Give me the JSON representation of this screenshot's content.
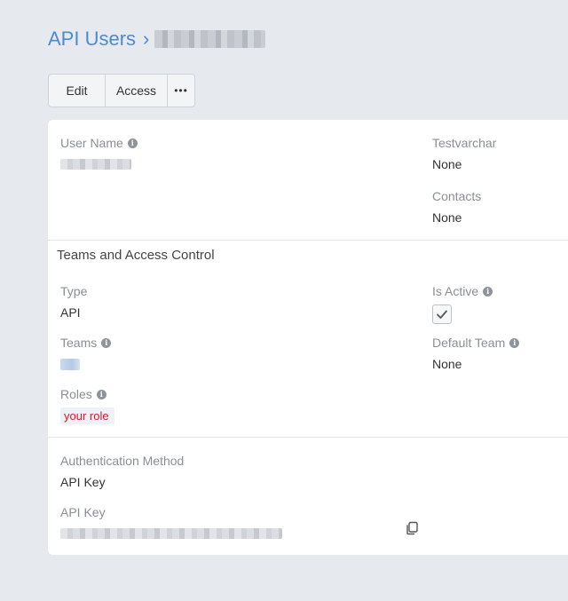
{
  "breadcrumb": {
    "root": "API Users",
    "separator": "›"
  },
  "toolbar": {
    "edit_label": "Edit",
    "access_label": "Access",
    "more_label": "•••"
  },
  "details": {
    "user_name": {
      "label": "User Name"
    },
    "testvarchar": {
      "label": "Testvarchar",
      "value": "None"
    },
    "contacts": {
      "label": "Contacts",
      "value": "None"
    }
  },
  "teams_access": {
    "title": "Teams and Access Control",
    "type": {
      "label": "Type",
      "value": "API"
    },
    "is_active": {
      "label": "Is Active",
      "checked": true
    },
    "teams": {
      "label": "Teams"
    },
    "default_team": {
      "label": "Default Team",
      "value": "None"
    },
    "roles": {
      "label": "Roles",
      "items": [
        "your role"
      ]
    }
  },
  "auth": {
    "method": {
      "label": "Authentication Method",
      "value": "API Key"
    },
    "api_key": {
      "label": "API Key"
    }
  },
  "icons": {
    "info": "info-icon",
    "check": "check-icon",
    "copy": "copy-icon",
    "more": "more-icon"
  },
  "colors": {
    "link": "#4f8bcb",
    "role_text": "#e0162b",
    "background": "#e6e9ee",
    "panel": "#ffffff"
  }
}
